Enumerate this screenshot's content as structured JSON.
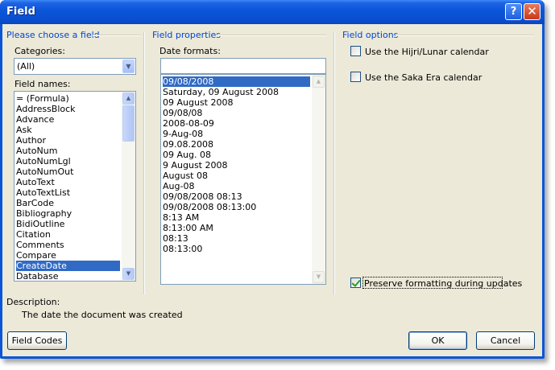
{
  "window": {
    "title": "Field",
    "help_label": "?",
    "close_label": "✕"
  },
  "left": {
    "group_title": "Please choose a field",
    "categories_label": "Categories:",
    "categories_value": "(All)",
    "field_names_label": "Field names:",
    "field_names": [
      "= (Formula)",
      "AddressBlock",
      "Advance",
      "Ask",
      "Author",
      "AutoNum",
      "AutoNumLgl",
      "AutoNumOut",
      "AutoText",
      "AutoTextList",
      "BarCode",
      "Bibliography",
      "BidiOutline",
      "Citation",
      "Comments",
      "Compare",
      "CreateDate",
      "Database"
    ],
    "selected_field": "CreateDate"
  },
  "middle": {
    "group_title": "Field properties",
    "date_formats_label": "Date formats:",
    "date_format_input": "",
    "date_formats": [
      "09/08/2008",
      "Saturday, 09 August 2008",
      "09 August 2008",
      "09/08/08",
      "2008-08-09",
      "9-Aug-08",
      "09.08.2008",
      "09 Aug. 08",
      "9 August 2008",
      "August 08",
      "Aug-08",
      "09/08/2008 08:13",
      "09/08/2008 08:13:00",
      "8:13 AM",
      "8:13:00 AM",
      "08:13",
      "08:13:00"
    ],
    "selected_format": "09/08/2008"
  },
  "right": {
    "group_title": "Field options",
    "option_hijri": "Use the Hijri/Lunar calendar",
    "option_saka": "Use the Saka Era calendar",
    "preserve_label": "Preserve formatting during updates",
    "hijri_checked": false,
    "saka_checked": false,
    "preserve_checked": true
  },
  "description": {
    "label": "Description:",
    "text": "The date the document was created"
  },
  "buttons": {
    "field_codes": "Field Codes",
    "ok": "OK",
    "cancel": "Cancel"
  },
  "colors": {
    "title_bar": "#0a55d8",
    "dialog_bg": "#ece9d8",
    "group_title": "#0046d5",
    "selection": "#316ac5"
  }
}
